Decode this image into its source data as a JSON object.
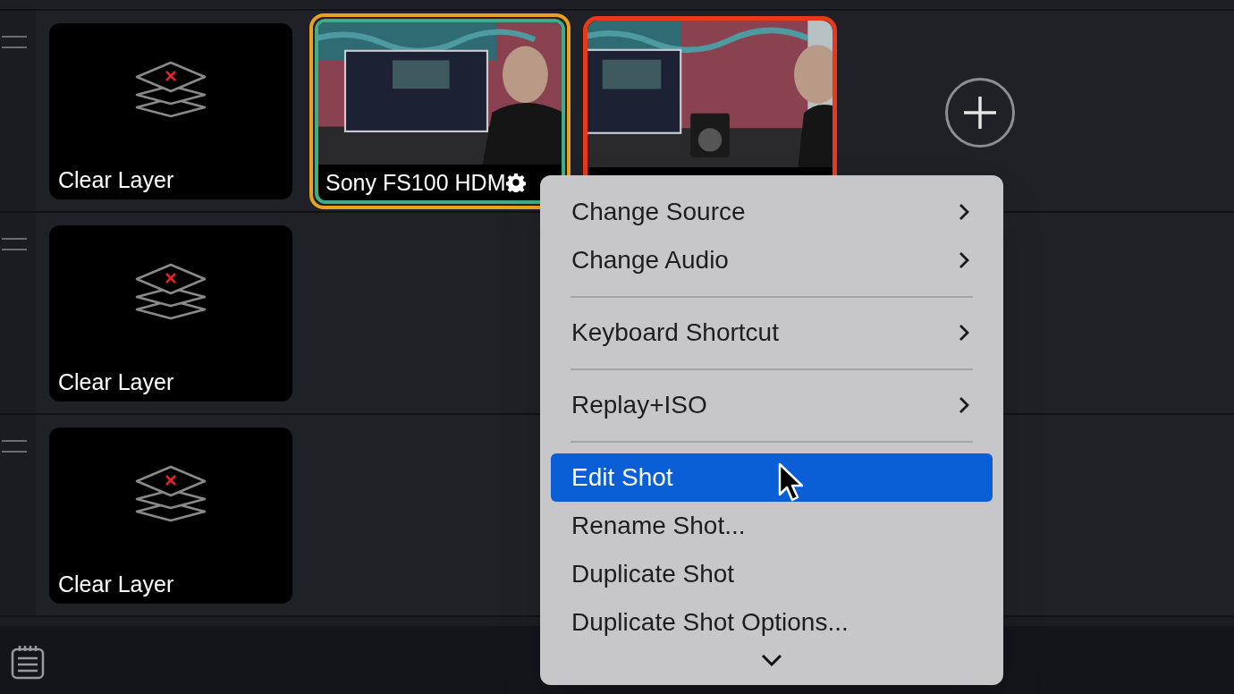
{
  "rows": [
    {
      "shots": [
        {
          "kind": "clear",
          "label": "Clear Layer"
        },
        {
          "kind": "camera",
          "label": "Sony FS100 HDM",
          "frames": [
            {
              "color": "#e8a21f"
            },
            {
              "color": "#3fae86"
            }
          ],
          "gear": true
        },
        {
          "kind": "camera",
          "frames": [
            {
              "color": "#e8391a"
            }
          ]
        }
      ],
      "add_button": true
    },
    {
      "shots": [
        {
          "kind": "clear",
          "label": "Clear Layer"
        }
      ]
    },
    {
      "shots": [
        {
          "kind": "clear",
          "label": "Clear Layer"
        }
      ]
    }
  ],
  "context_menu": {
    "items": [
      {
        "kind": "item",
        "label": "Change Source",
        "submenu": true,
        "selected": false
      },
      {
        "kind": "item",
        "label": "Change Audio",
        "submenu": true,
        "selected": false
      },
      {
        "kind": "separator"
      },
      {
        "kind": "item",
        "label": "Keyboard Shortcut",
        "submenu": true,
        "selected": false
      },
      {
        "kind": "separator"
      },
      {
        "kind": "item",
        "label": "Replay+ISO",
        "submenu": true,
        "selected": false
      },
      {
        "kind": "separator"
      },
      {
        "kind": "item",
        "label": "Edit Shot",
        "submenu": false,
        "selected": true
      },
      {
        "kind": "item",
        "label": "Rename Shot...",
        "submenu": false,
        "selected": false
      },
      {
        "kind": "item",
        "label": "Duplicate Shot",
        "submenu": false,
        "selected": false
      },
      {
        "kind": "item",
        "label": "Duplicate Shot Options...",
        "submenu": false,
        "selected": false
      }
    ],
    "more_below": true
  }
}
